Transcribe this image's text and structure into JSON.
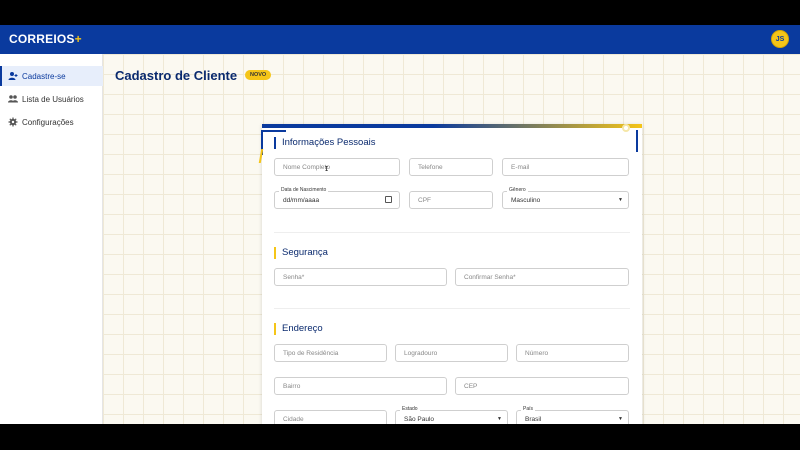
{
  "app": {
    "logo_text": "CORREIOS",
    "logo_plus": "+",
    "avatar_initials": "JS"
  },
  "sidebar": {
    "items": [
      {
        "label": "Cadastre-se",
        "icon": "user-plus-icon",
        "active": true
      },
      {
        "label": "Lista de Usuários",
        "icon": "users-icon",
        "active": false
      },
      {
        "label": "Configurações",
        "icon": "gear-icon",
        "active": false
      }
    ]
  },
  "main": {
    "title": "Cadastro de Cliente",
    "badge": "NOVO"
  },
  "form": {
    "personal": {
      "title": "Informações Pessoais",
      "name_placeholder": "Nome Completo",
      "phone_placeholder": "Telefone",
      "email_placeholder": "E-mail",
      "birth_label": "Data de Nascimento",
      "birth_value": "dd/mm/aaaa",
      "cpf_placeholder": "CPF",
      "gender_label": "Gênero",
      "gender_value": "Masculino"
    },
    "security": {
      "title": "Segurança",
      "password_placeholder": "Senha*",
      "confirm_placeholder": "Confirmar Senha*"
    },
    "address": {
      "title": "Endereço",
      "residence_type_placeholder": "Tipo de Residência",
      "street_placeholder": "Logradouro",
      "number_placeholder": "Número",
      "neighborhood_placeholder": "Bairro",
      "zip_placeholder": "CEP",
      "city_placeholder": "Cidade",
      "state_label": "Estado",
      "state_value": "São Paulo",
      "country_label": "País",
      "country_value": "Brasil"
    }
  },
  "colors": {
    "primary": "#0a3a9e",
    "accent": "#f5c518"
  }
}
